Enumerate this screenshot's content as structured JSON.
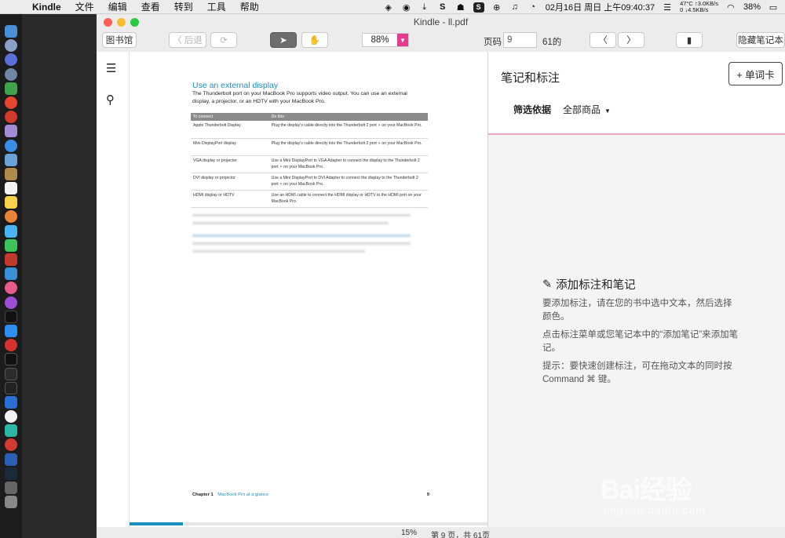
{
  "menubar": {
    "app_name": "Kindle",
    "items": [
      "文件",
      "编辑",
      "查看",
      "转到",
      "工具",
      "帮助"
    ],
    "temperature": "47°C",
    "net_up": "↑3.0KB/s",
    "net_down": "0  ↓4.5KB/s",
    "datetime": "02月16日 周日 上午09:40:37",
    "battery": "38%"
  },
  "window": {
    "title": "Kindle - ll.pdf"
  },
  "toolbar": {
    "library_label": "图书馆",
    "back_label": "后退",
    "zoom_value": "88%",
    "page_label": "页码",
    "page_value": "9",
    "page_total": "61的",
    "hide_notes_label": "隐藏笔记本"
  },
  "document": {
    "title": "Use an external display",
    "intro": "The Thunderbolt port on your MacBook Pro supports video output. You can use an external display, a projector, or an HDTV with your MacBook Pro.",
    "table_headers": [
      "To connect",
      "Do this"
    ],
    "table_rows": [
      [
        "Apple Thunderbolt Display",
        "Plug the display's cable directly into the Thunderbolt 2 port ⚡ on your MacBook Pro."
      ],
      [
        "Mini DisplayPort display",
        "Plug the display's cable directly into the Thunderbolt 2 port ⚡ on your MacBook Pro."
      ],
      [
        "VGA display or projector",
        "Use a Mini DisplayPort to VGA Adapter to connect the display to the Thunderbolt 2 port ⚡ on your MacBook Pro."
      ],
      [
        "DVI display or projector",
        "Use a Mini DisplayPort to DVI Adapter to connect the display to the Thunderbolt 2 port ⚡ on your MacBook Pro."
      ],
      [
        "HDMI display or HDTV",
        "Use an HDMI cable to connect the HDMI display or HDTV to the HDMI port on your MacBook Pro."
      ]
    ],
    "footer_chapter": "Chapter 1",
    "footer_section": "MacBook Pro at a glance",
    "footer_page": "9",
    "progress_fraction": 0.15
  },
  "statusbar": {
    "percent": "15%",
    "page_info": "第 9 页，共 61页"
  },
  "notes": {
    "title": "笔记和标注",
    "flashcard_label": "+ 单词卡",
    "filter_label": "筛选依据",
    "filter_value": "全部商品",
    "empty_title": "添加标注和笔记",
    "tip1": "要添加标注，请在您的书中选中文本，然后选择颜色。",
    "tip2": "点击标注菜单或您笔记本中的“添加笔记”来添加笔记。",
    "tip3": "提示：要快速创建标注，可在拖动文本的同时按 Command ⌘ 键。"
  },
  "watermark": {
    "brand": "Bai经验",
    "url": "jingyan.baidu.com"
  },
  "colors": {
    "accent_pink": "#e43b8f",
    "link_blue": "#1b8fc1"
  }
}
